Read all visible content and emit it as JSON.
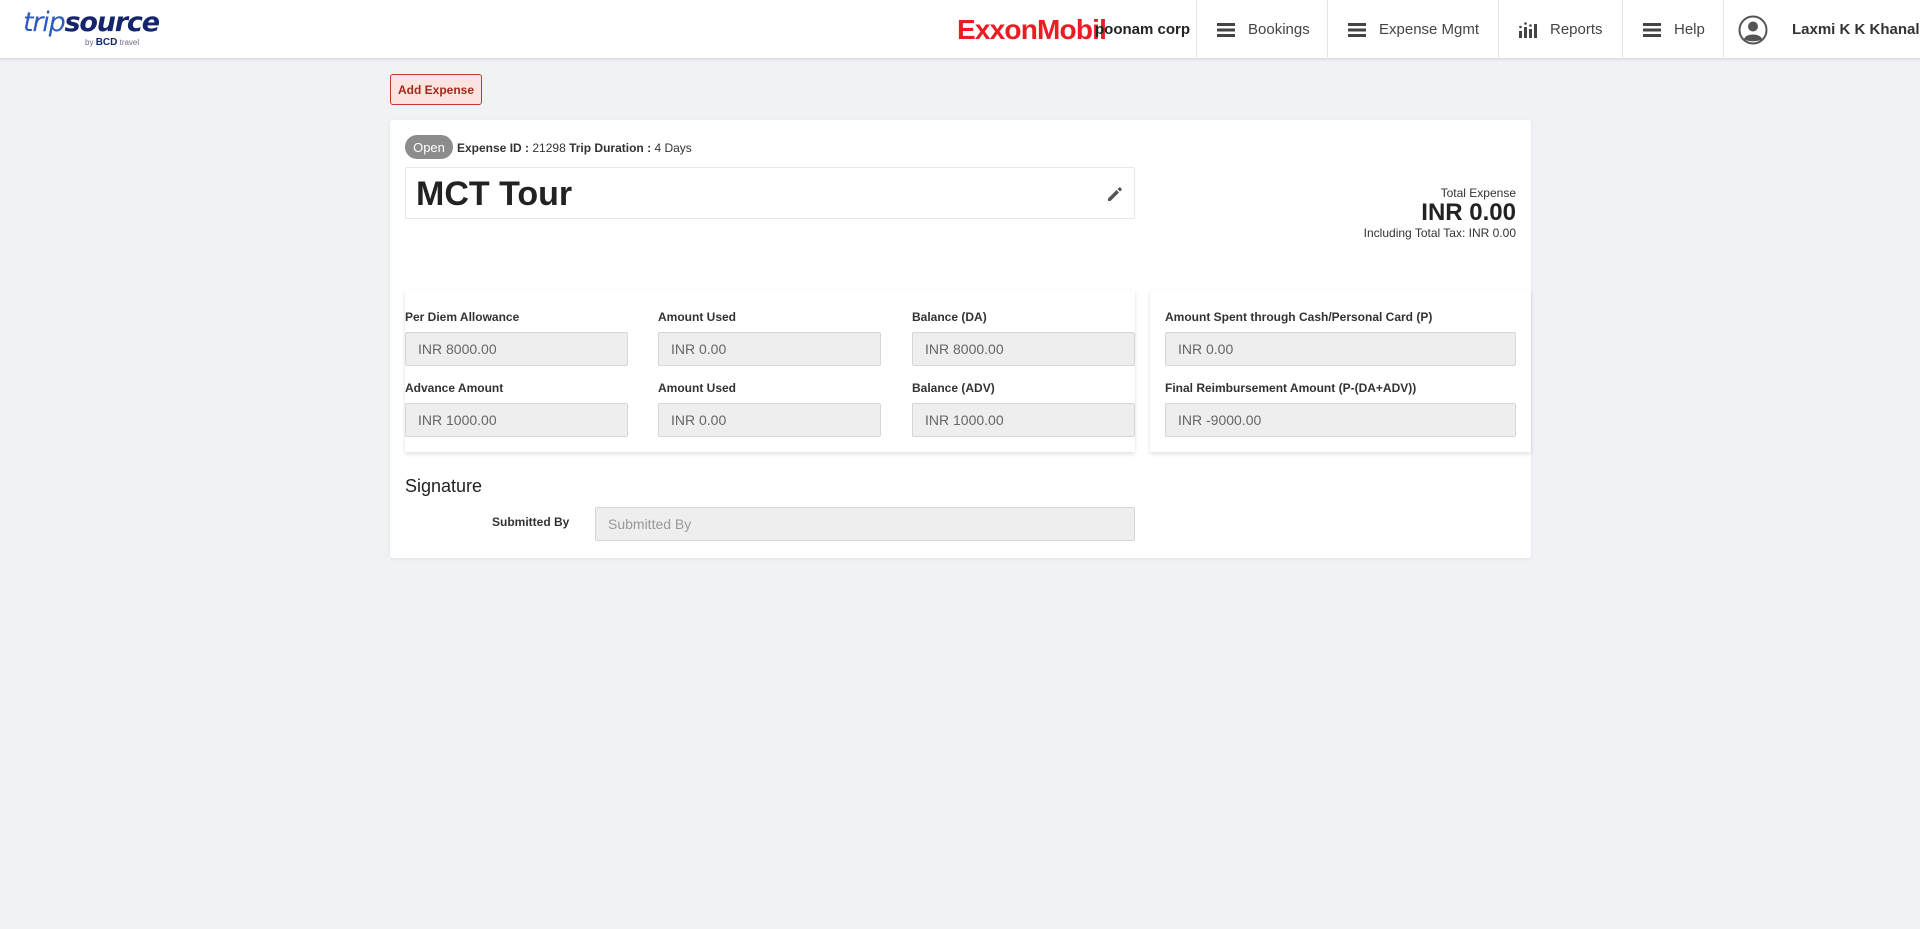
{
  "header": {
    "logo": {
      "part1": "trip",
      "part2": "source",
      "sub_by": "by",
      "sub_bcd": "BCD",
      "sub_travel": "travel"
    },
    "brand": "ExxonMobil",
    "corp": "poonam corp",
    "nav": [
      {
        "label": "Bookings",
        "icon": "menu-icon"
      },
      {
        "label": "Expense Mgmt",
        "icon": "menu-icon"
      },
      {
        "label": "Reports",
        "icon": "bar-chart-icon"
      },
      {
        "label": "Help",
        "icon": "menu-icon"
      }
    ],
    "user": {
      "name": "Laxmi K K Khanal",
      "icon": "user-avatar-icon"
    }
  },
  "actions": {
    "add_expense": "Add Expense"
  },
  "expense": {
    "status": "Open",
    "id_label": "Expense ID :",
    "id_value": "21298",
    "duration_label": "Trip Duration :",
    "duration_value": "4 Days",
    "title": "MCT Tour",
    "total_label": "Total Expense",
    "total_value": "INR 0.00",
    "tax_text": "Including Total Tax: INR 0.00"
  },
  "fields": {
    "per_diem": {
      "label": "Per Diem Allowance",
      "value": "INR 8000.00"
    },
    "da_used": {
      "label": "Amount Used",
      "value": "INR 0.00"
    },
    "da_balance": {
      "label": "Balance (DA)",
      "value": "INR 8000.00"
    },
    "advance": {
      "label": "Advance Amount",
      "value": "INR 1000.00"
    },
    "adv_used": {
      "label": "Amount Used",
      "value": "INR 0.00"
    },
    "adv_balance": {
      "label": "Balance (ADV)",
      "value": "INR 1000.00"
    },
    "spent_personal": {
      "label": "Amount Spent through Cash/Personal Card (P)",
      "value": "INR 0.00"
    },
    "final_reimb": {
      "label": "Final Reimbursement Amount (P-(DA+ADV))",
      "value": "INR -9000.00"
    }
  },
  "signature": {
    "title": "Signature",
    "submitted_by_label": "Submitted By",
    "submitted_by_placeholder": "Submitted By",
    "submitted_by_value": ""
  },
  "colors": {
    "accent_red": "#ec1c24",
    "add_button_border": "#c0392b",
    "logo_blue": "#2c5cbf",
    "logo_navy": "#14256b",
    "status_badge": "#8c8c8c",
    "page_background": "#f1f2f6"
  }
}
